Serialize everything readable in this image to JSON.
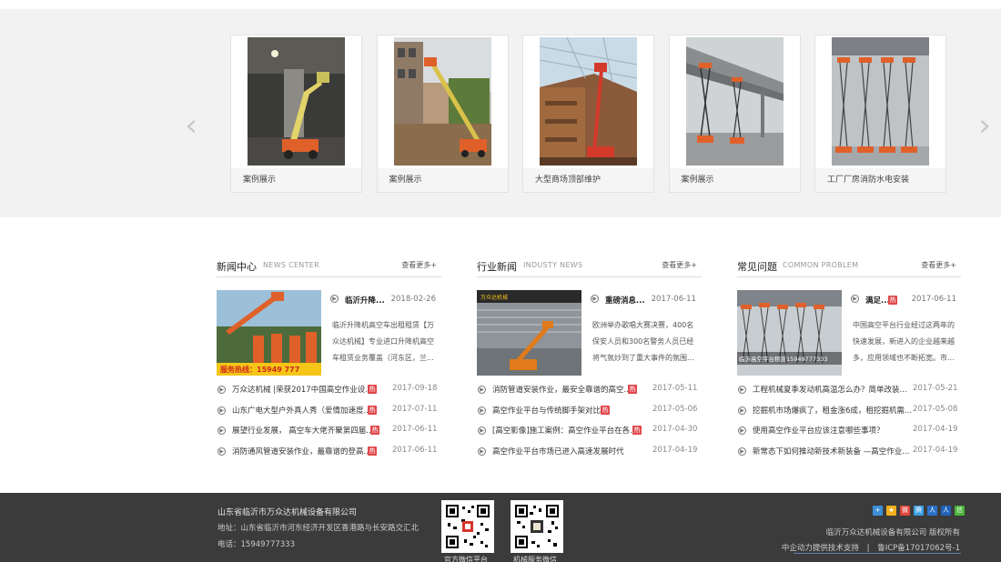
{
  "showcase": {
    "prev_arrow": "‹",
    "next_arrow": "›",
    "cases": [
      {
        "caption": "案例展示"
      },
      {
        "caption": "案例展示"
      },
      {
        "caption": "大型商场顶部维护"
      },
      {
        "caption": "案例展示"
      },
      {
        "caption": "工厂厂房消防水电安装"
      }
    ]
  },
  "sections": [
    {
      "title": "新闻中心",
      "subtitle": "NEWS CENTER",
      "more": "查看更多+",
      "feature": {
        "title": "临沂升降...",
        "hot": "",
        "date": "2018-02-26",
        "desc": "临沂升降机高空车出租租赁【万众达机械】专业进口升降机高空车租赁业务覆盖（河东区，兰...",
        "img_text": "服务热线：15949 777"
      },
      "items": [
        {
          "text": "万众达机械 |荣获2017中国高空作业设...",
          "hot": "热",
          "date": "2017-09-18"
        },
        {
          "text": "山东广电大型户外真人秀（爱情加速度...",
          "hot": "热",
          "date": "2017-07-11"
        },
        {
          "text": "展望行业发展， 高空车大佬齐聚第四届...",
          "hot": "热",
          "date": "2017-06-11"
        },
        {
          "text": "消防通风管道安装作业，最靠谱的登高...",
          "hot": "热",
          "date": "2017-06-11"
        }
      ]
    },
    {
      "title": "行业新闻",
      "subtitle": "INDUSTY NEWS",
      "more": "查看更多+",
      "feature": {
        "title": "重磅消息...",
        "hot": "",
        "date": "2017-06-11",
        "desc": "欧洲举办歌唱大赛决赛，400名保安人员和300名警务人员已经将气氛炒到了重大事件的氛围...",
        "img_text": "万众达机械"
      },
      "items": [
        {
          "text": "消防管道安装作业，最安全靠谱的高空...",
          "hot": "热",
          "date": "2017-05-11"
        },
        {
          "text": "高空作业平台与传统脚手架对比",
          "hot": "热",
          "date": "2017-05-06"
        },
        {
          "text": "[高空影像]施工案例：高空作业平台在各...",
          "hot": "热",
          "date": "2017-04-30"
        },
        {
          "text": "高空作业平台市场已进入高速发展时代",
          "hot": "",
          "date": "2017-04-19"
        }
      ]
    },
    {
      "title": "常见问题",
      "subtitle": "COMMON PROBLEM",
      "more": "查看更多+",
      "feature": {
        "title": "满足...",
        "hot": "热",
        "date": "2017-06-11",
        "desc": "中国高空平台行业经过这两年的快速发展，新进入的企业越来越多，应用领域也不断拓宽。市...",
        "img_text": "临沂高空平台租赁15949777333"
      },
      "items": [
        {
          "text": "工程机械夏季发动机高温怎么办？简单改装...",
          "hot": "",
          "date": "2017-05-21"
        },
        {
          "text": "挖掘机市场爆疯了，租金涨6成，租挖掘机需...",
          "hot": "",
          "date": "2017-05-08"
        },
        {
          "text": "使用高空作业平台应该注意哪些事项？",
          "hot": "",
          "date": "2017-04-19"
        },
        {
          "text": "新常态下如何推动新技术新装备 —高空作业...",
          "hot": "",
          "date": "2017-04-19"
        }
      ]
    }
  ],
  "footer": {
    "company": "山东省临沂市万众达机械设备有限公司",
    "address": "地址：山东省临沂市河东经济开发区香港路与长安路交汇北",
    "tel": "电话：15949777333",
    "qr1_label": "官方微信平台",
    "qr2_label": "机械服务微信",
    "copyright": "临沂万众达机械设备有限公司 版权所有",
    "support": "中企动力提供技术支持",
    "divider": "|",
    "icp": "鲁ICP备17017062号-1",
    "share_icons": [
      {
        "name": "plus-share-icon",
        "glyph": "+",
        "color": "#3d8fd6"
      },
      {
        "name": "qzone-share-icon",
        "glyph": "★",
        "color": "#f2b01e"
      },
      {
        "name": "weibo-share-icon",
        "glyph": "微",
        "color": "#e0463c"
      },
      {
        "name": "tencent-weibo-share-icon",
        "glyph": "腾",
        "color": "#3a9de0"
      },
      {
        "name": "people-share-icon",
        "glyph": "人",
        "color": "#2a6fc9"
      },
      {
        "name": "renren-share-icon",
        "glyph": "人",
        "color": "#1f62b8"
      },
      {
        "name": "wechat-share-icon",
        "glyph": "信",
        "color": "#4ab53a"
      }
    ],
    "colors": {
      "bg": "#3b3b3b",
      "hot": "#e0464a"
    }
  }
}
